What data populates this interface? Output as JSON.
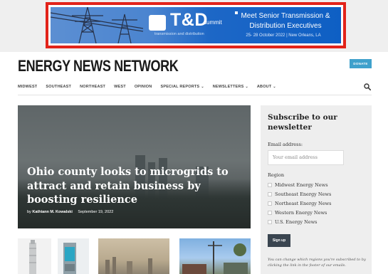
{
  "ad": {
    "logo": "T&D",
    "logo_sub": "summit",
    "tagline": "transmission and distribution",
    "headline": "Meet Senior Transmission & Distribution Executives",
    "dates": "25- 28 October 2022 | New Orleans, LA",
    "frame_color": "#e2231a"
  },
  "header": {
    "site_title": "ENERGY NEWS NETWORK",
    "donate_label": "DONATE"
  },
  "nav": {
    "items": [
      "MIDWEST",
      "SOUTHEAST",
      "NORTHEAST",
      "WEST",
      "OPINION",
      "SPECIAL REPORTS",
      "NEWSLETTERS",
      "ABOUT"
    ],
    "dropdown_items": [
      "SPECIAL REPORTS",
      "NEWSLETTERS",
      "ABOUT"
    ],
    "search_icon": "search-icon"
  },
  "hero": {
    "title": "Ohio county looks to microgrids to attract and retain business by boosting resilience",
    "byline_prefix": "by",
    "author": "Kathiann M. Kowalski",
    "date": "September 19, 2022"
  },
  "subscribe": {
    "title": "Subscribe to our newsletter",
    "email_label": "Email address:",
    "email_placeholder": "Your email address",
    "region_label": "Region",
    "regions": [
      "Midwest Energy News",
      "Southeast Energy News",
      "Northeast Energy News",
      "Western Energy News",
      "U.S. Energy News"
    ],
    "signup_label": "Sign up",
    "note": "You can change which regions you're subscribed to by clicking the link in the footer of our emails."
  },
  "colors": {
    "accent": "#3fa1cc",
    "signup": "#3a4550",
    "panel": "#eeeeee"
  }
}
